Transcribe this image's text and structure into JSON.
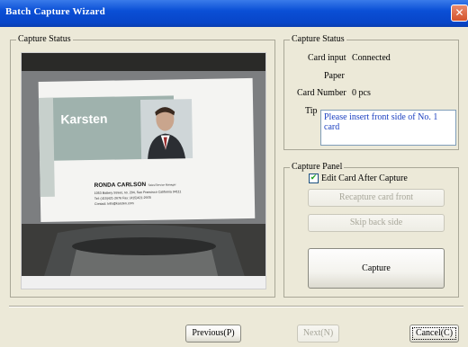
{
  "window": {
    "title": "Batch Capture Wizard",
    "close_icon": "close-icon"
  },
  "left_panel": {
    "group_label": "Capture Status",
    "card": {
      "company": "Karsten",
      "name": "RONDA CARLSON",
      "name_title": "Sales/Service Manager",
      "address": "1053 Battery Street, no. 204, San Francisco California 94111",
      "phone": "Tel: (415)421-2676   Fax: (415)421-2978",
      "contact": "Contact: Info@karsten.com"
    }
  },
  "status": {
    "group_label": "Capture Status",
    "card_input_label": "Card input",
    "card_input_value": "Connected",
    "paper_label": "Paper",
    "paper_value": "",
    "card_number_label": "Card Number",
    "card_number_value": "0 pcs",
    "tip_label": "Tip",
    "tip_text": "Please insert front side of No. 1 card"
  },
  "panel": {
    "group_label": "Capture Panel",
    "edit_card_label": "Edit Card After Capture",
    "edit_card_checked": true,
    "recapture_label": "Recapture card front",
    "skip_back_label": "Skip back side",
    "capture_label": "Capture"
  },
  "footer": {
    "previous_label": "Previous(P)",
    "next_label": "Next(N)",
    "cancel_label": "Cancel(C)"
  }
}
